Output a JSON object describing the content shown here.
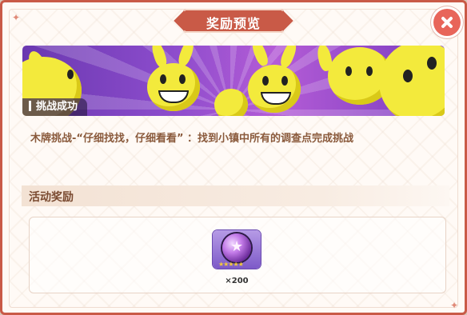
{
  "header": {
    "title": "奖励预览"
  },
  "banner": {
    "tag": "挑战成功"
  },
  "description": "木牌挑战-“仔细找找，仔细看看” ：找到小镇中所有的调查点完成挑战",
  "rewards_section": {
    "title": "活动奖励"
  },
  "reward": {
    "quantity": "×200",
    "stars": "★★★★★"
  },
  "colors": {
    "accent": "#c95a47",
    "close": "#e8655a",
    "text_brown": "#8a5a3c"
  },
  "icons": {
    "close": "close-icon",
    "reward": "purple-orb-icon"
  }
}
